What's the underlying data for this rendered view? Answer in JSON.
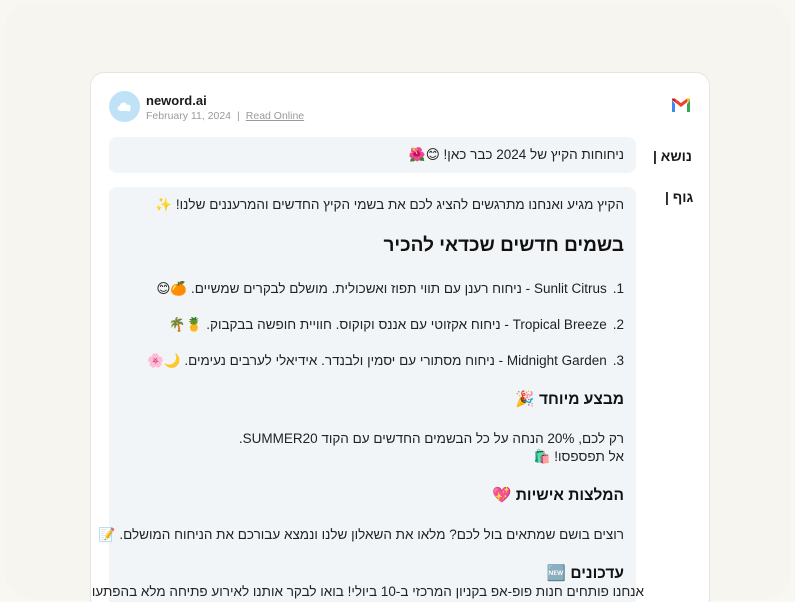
{
  "sender": {
    "name": "neword.ai",
    "date": "February 11, 2024",
    "separator": "|",
    "read_online": "Read Online"
  },
  "labels": {
    "subject": "נושא |",
    "body": "גוף |"
  },
  "subject": "ניחוחות הקיץ של 2024 כבר כאן! 😊🌺",
  "body": {
    "intro": "הקיץ מגיע ואנחנו מתרגשים להציג לכם את בשמי הקיץ החדשים והמרעננים שלנו! ✨",
    "heading": "בשמים חדשים שכדאי להכיר",
    "items": [
      {
        "num": "1.",
        "text": "Sunlit Citrus - ניחוח רענן עם תווי תפוז ואשכולית. מושלם לבקרים שמשיים. 🍊😊"
      },
      {
        "num": "2.",
        "text": "Tropical Breeze - ניחוח אקזוטי עם אננס וקוקוס. חוויית חופשה בבקבוק. 🍍🌴"
      },
      {
        "num": "3.",
        "text": "Midnight Garden - ניחוח מסתורי עם יסמין ולבנדר. אידיאלי לערבים נעימים. 🌙🌸"
      }
    ],
    "offer_heading": "מבצע מיוחד 🎉",
    "offer_line1": "רק לכם, 20% הנחה על כל הבשמים החדשים עם הקוד SUMMER20.",
    "offer_line2": "אל תפספסו! 🛍️",
    "reco_heading": "המלצות אישיות 💖",
    "reco_text": "רוצים בושם שמתאים בול לכם? מלאו את השאלון שלנו ונמצא עבורכם את הניחוח המושלם. 📝",
    "updates_heading": "עדכונים 🆕",
    "updates_text": "אנחנו פותחים חנות פופ-אפ בקניון המרכזי ב-10 ביולי! בואו לבקר אותנו לאירוע פתיחה מלא בהפתעו"
  }
}
